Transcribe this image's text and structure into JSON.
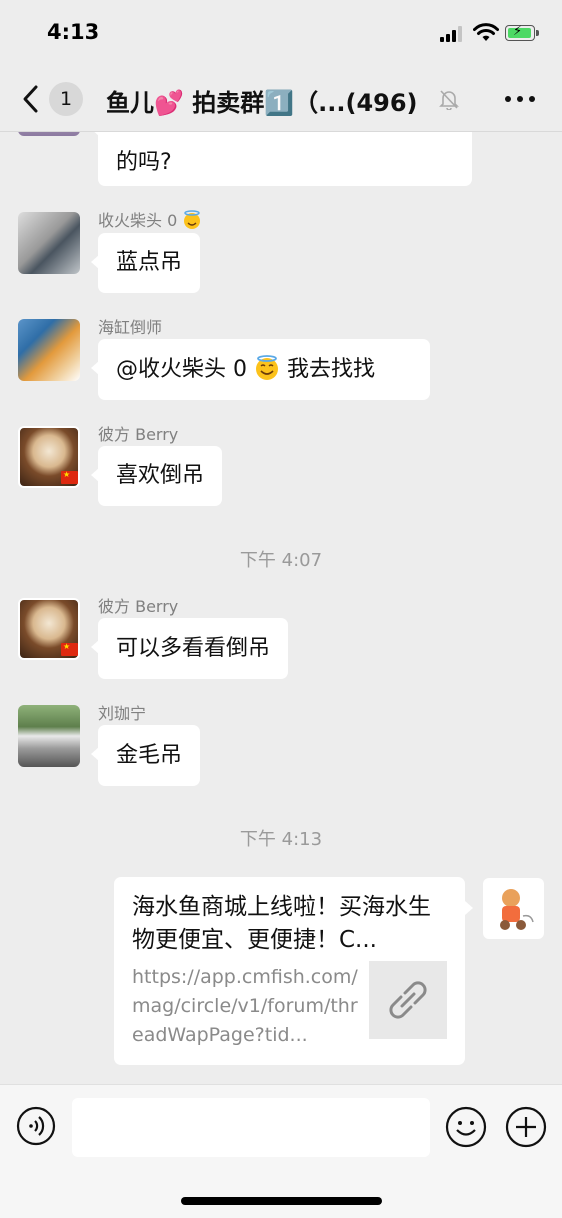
{
  "status_bar": {
    "time": "4:13"
  },
  "header": {
    "unread_count": "1",
    "title": "鱼儿💕 拍卖群1️⃣（...(496)"
  },
  "messages": [
    {
      "text": "的吗?"
    },
    {
      "sender": "收火柴头 0",
      "text": "蓝点吊"
    },
    {
      "sender": "海缸倒师",
      "mention": "@收火柴头 0",
      "text": " 我去找找"
    },
    {
      "sender": "彼方 Berry",
      "text": "喜欢倒吊"
    },
    {
      "timestamp": "下午 4:07"
    },
    {
      "sender": "彼方 Berry",
      "text": "可以多看看倒吊"
    },
    {
      "sender": "刘珈宁",
      "text": "金毛吊"
    },
    {
      "timestamp": "下午 4:13"
    }
  ],
  "link_card": {
    "title": "海水鱼商城上线啦！买海水生物更便宜、更便捷！C...",
    "url": "https://app.cmfish.com/mag/circle/v1/forum/threadWapPage?tid..."
  },
  "input_bar": {
    "value": ""
  },
  "icons": {
    "back": "chevron-left-icon",
    "mute": "bell-slash-icon",
    "more": "more-icon",
    "voice": "voice-icon",
    "emoji": "emoji-icon",
    "add": "plus-circle-icon",
    "link": "link-icon"
  },
  "colors": {
    "background": "#ededed",
    "bubble": "#ffffff",
    "battery": "#4cd964"
  }
}
